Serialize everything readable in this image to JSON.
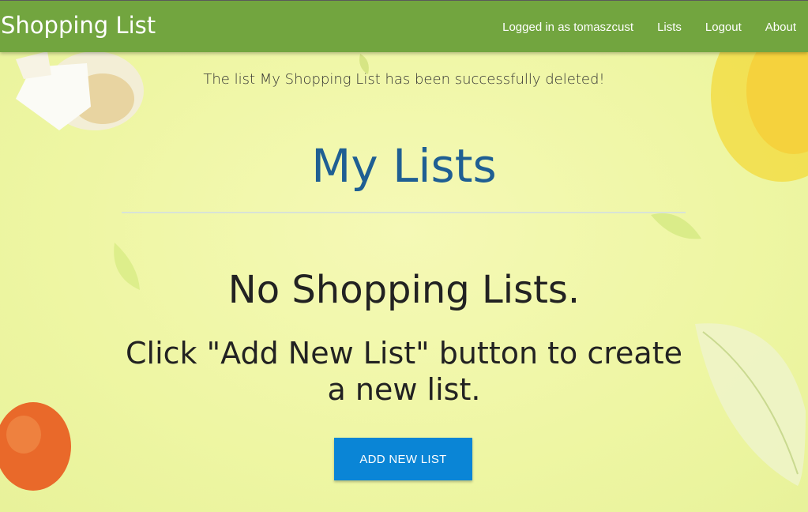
{
  "navbar": {
    "brand": "Shopping List",
    "links": [
      {
        "label": "Logged in as tomaszcust"
      },
      {
        "label": "Lists"
      },
      {
        "label": "Logout"
      },
      {
        "label": "About"
      }
    ],
    "color": "#72a53f"
  },
  "flash": {
    "message": "The list My Shopping List has been successfully deleted!"
  },
  "main": {
    "title": "My Lists",
    "empty_heading": "No Shopping Lists.",
    "empty_text": "Click \"Add New List\" button to create a new list.",
    "add_button_label": "ADD NEW LIST"
  },
  "colors": {
    "accent_button": "#0a85d6",
    "title": "#1f5f93",
    "background": "#f0f7a6"
  }
}
